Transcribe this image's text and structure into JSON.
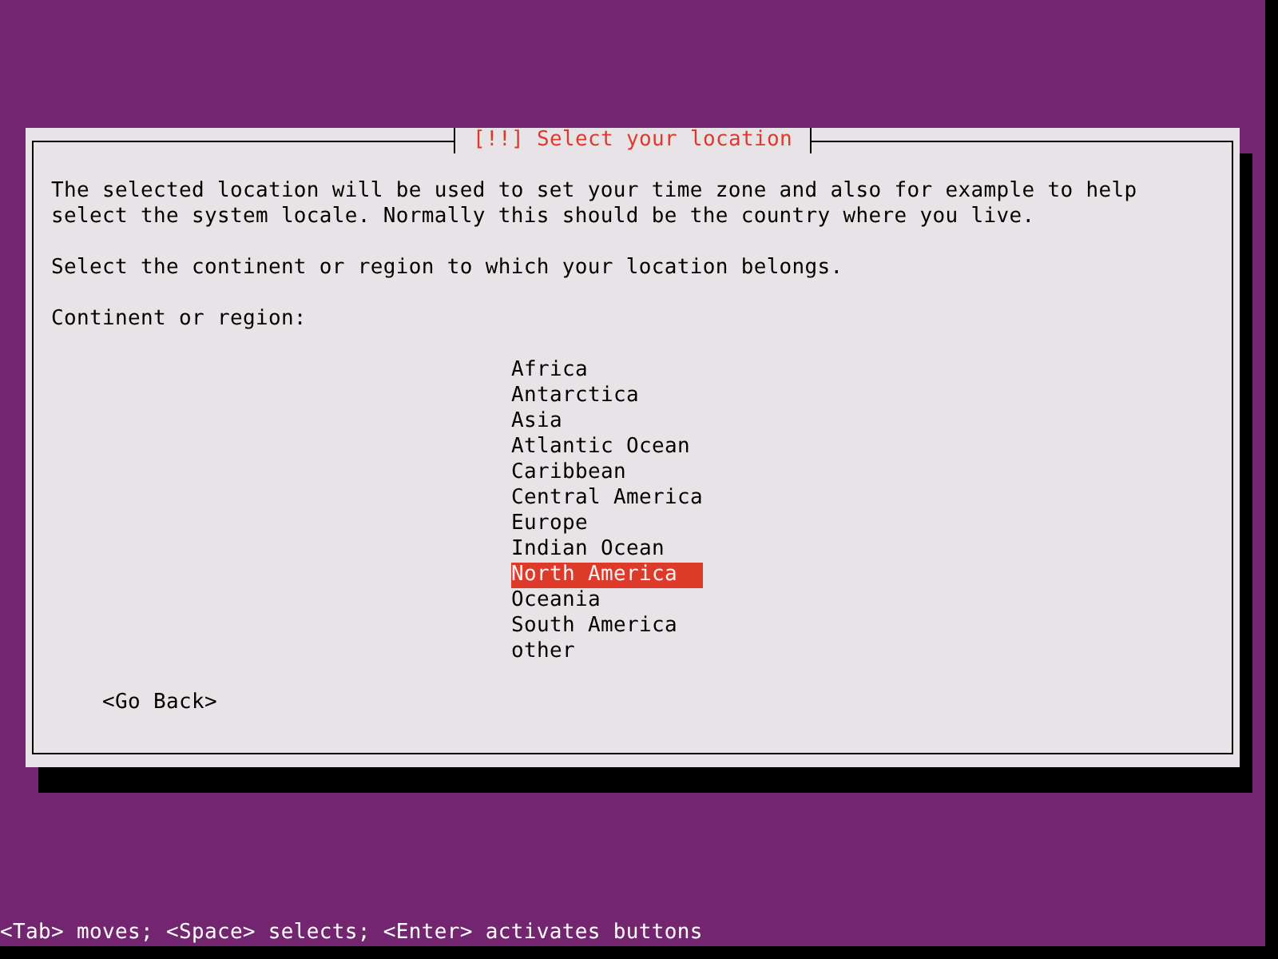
{
  "dialog": {
    "title": "[!!] Select your location",
    "description": "The selected location will be used to set your time zone and also for example to help select the system locale. Normally this should be the country where you live.",
    "prompt": "Select the continent or region to which your location belongs.",
    "list_label": "Continent or region:",
    "options": [
      {
        "label": "Africa",
        "selected": false
      },
      {
        "label": "Antarctica",
        "selected": false
      },
      {
        "label": "Asia",
        "selected": false
      },
      {
        "label": "Atlantic Ocean",
        "selected": false
      },
      {
        "label": "Caribbean",
        "selected": false
      },
      {
        "label": "Central America",
        "selected": false
      },
      {
        "label": "Europe",
        "selected": false
      },
      {
        "label": "Indian Ocean",
        "selected": false
      },
      {
        "label": "North America",
        "selected": true
      },
      {
        "label": "Oceania",
        "selected": false
      },
      {
        "label": "South America",
        "selected": false
      },
      {
        "label": "other",
        "selected": false
      }
    ],
    "buttons": [
      {
        "label": "<Go Back>"
      }
    ]
  },
  "status_bar": "<Tab> moves; <Space> selects; <Enter> activates buttons"
}
